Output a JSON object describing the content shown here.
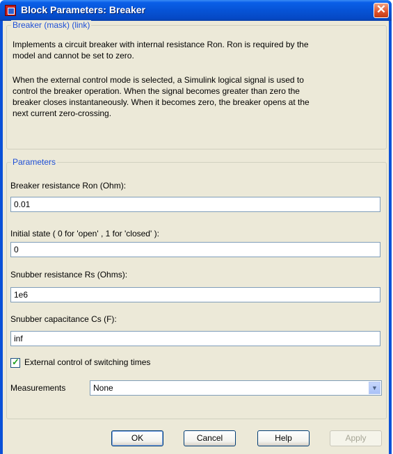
{
  "window": {
    "title": "Block Parameters: Breaker",
    "close_symbol": "✕"
  },
  "mask": {
    "group_label": "Breaker (mask) (link)",
    "description_1": [
      "Implements a circuit breaker with internal resistance Ron. Ron is required by the",
      "model  and cannot be set to zero."
    ],
    "description_2": [
      "When the external control mode is selected, a Simulink  logical signal is used to",
      "control the breaker operation.  When  the signal becomes greater than zero the",
      "breaker closes instantaneously.  When it becomes zero, the breaker opens at the",
      "next current zero-crossing."
    ]
  },
  "parameters": {
    "group_label": "Parameters",
    "ron": {
      "label": "Breaker resistance Ron (Ohm):",
      "value": "0.01"
    },
    "initial_state": {
      "label": "Initial state ( 0 for 'open' , 1 for 'closed' ):",
      "value": "0"
    },
    "rs": {
      "label": "Snubber resistance Rs (Ohms):",
      "value": "1e6"
    },
    "cs": {
      "label": "Snubber capacitance Cs (F):",
      "value": "inf"
    },
    "external_control": {
      "label": "External control of switching times",
      "checked": true,
      "mark": "✓"
    },
    "measurements": {
      "label": "Measurements",
      "value": "None",
      "arrow": "▼"
    }
  },
  "buttons": {
    "ok": "OK",
    "cancel": "Cancel",
    "help": "Help",
    "apply": "Apply"
  },
  "colors": {
    "title_bar": "#0653d6",
    "group_label": "#1e4fd6",
    "dialog_bg": "#ece9d8"
  }
}
